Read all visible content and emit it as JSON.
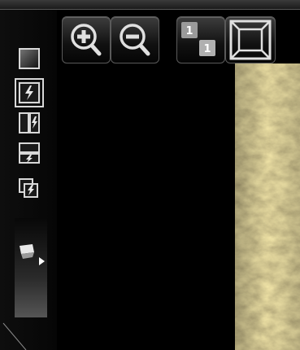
{
  "toolbar": {
    "zoom_in": {
      "icon": "zoom-in-icon"
    },
    "zoom_out": {
      "icon": "zoom-out-icon"
    },
    "actual_size": {
      "icon": "actual-size-icon",
      "badge_top": "1",
      "badge_bottom": "1"
    },
    "fit_window": {
      "icon": "fit-window-icon"
    }
  },
  "view_modes": [
    {
      "icon": "single-view-icon",
      "active": false
    },
    {
      "icon": "flash-view-icon",
      "active": true
    },
    {
      "icon": "side-by-side-view-icon",
      "active": false
    },
    {
      "icon": "top-bottom-view-icon",
      "active": false
    },
    {
      "icon": "overlay-view-icon",
      "active": false
    }
  ],
  "exposure_slider": {
    "icon": "light-source-icon"
  },
  "colors": {
    "background": "#000000",
    "button_border": "#5a5a5a",
    "icon_light": "#d8d8d8",
    "active_outline": "#d8d8d8"
  }
}
